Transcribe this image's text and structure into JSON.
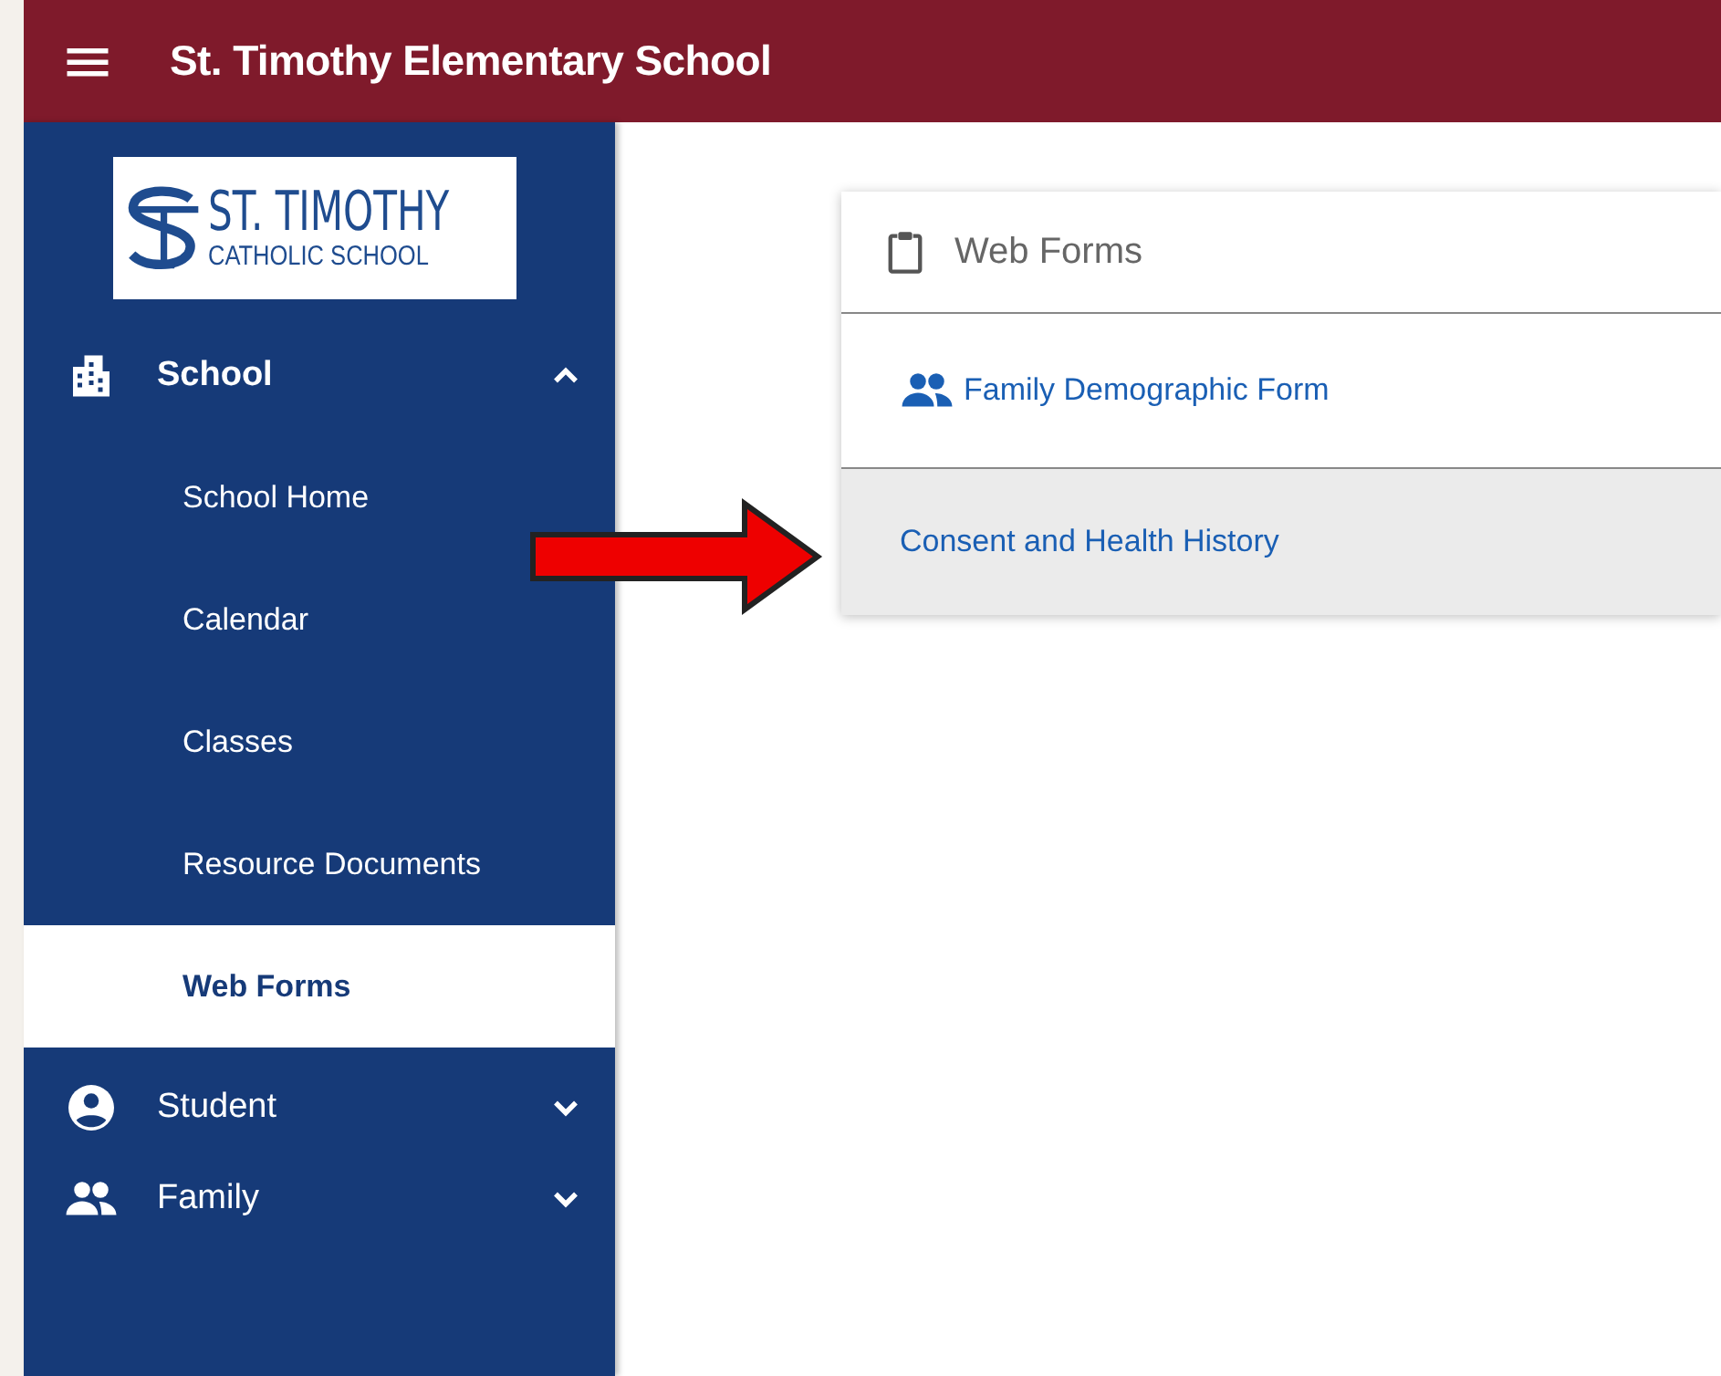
{
  "header": {
    "title": "St. Timothy Elementary School"
  },
  "logo": {
    "name": "ST. TIMOTHY",
    "subtitle": "CATHOLIC SCHOOL"
  },
  "nav": [
    {
      "label": "School",
      "kind": "building",
      "expanded": true,
      "children": [
        {
          "label": "School Home",
          "selected": false
        },
        {
          "label": "Calendar",
          "selected": false
        },
        {
          "label": "Classes",
          "selected": false
        },
        {
          "label": "Resource Documents",
          "selected": false
        },
        {
          "label": "Web Forms",
          "selected": true
        }
      ]
    },
    {
      "label": "Student",
      "kind": "account",
      "expanded": false
    },
    {
      "label": "Family",
      "kind": "people",
      "expanded": false
    }
  ],
  "card": {
    "title": "Web Forms",
    "forms": [
      {
        "label": "Family Demographic Form",
        "kind": "people",
        "highlighted": false
      },
      {
        "label": "Consent and Health History",
        "kind": "plain",
        "highlighted": true
      }
    ]
  }
}
